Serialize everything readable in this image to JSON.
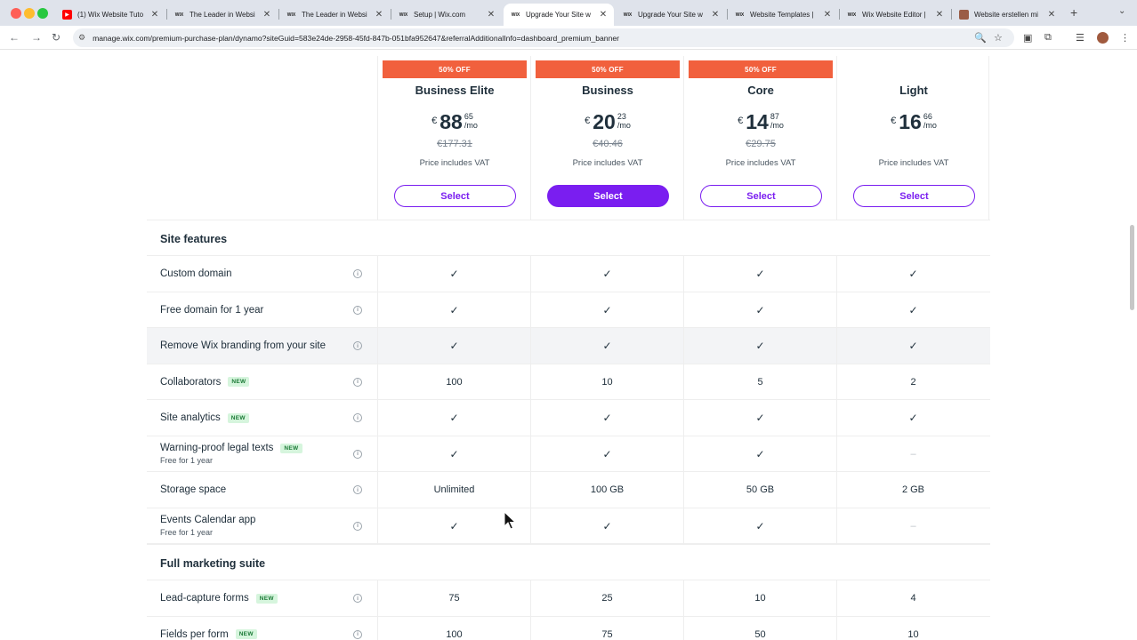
{
  "browser": {
    "tabs": [
      {
        "title": "(1) Wix Website Tuto",
        "icon": "youtube-icon",
        "active": false
      },
      {
        "title": "The Leader in Websi",
        "icon": "wix-icon",
        "active": false
      },
      {
        "title": "The Leader in Websi",
        "icon": "wix-icon",
        "active": false
      },
      {
        "title": "Setup | Wix.com",
        "icon": "wix-icon",
        "active": false
      },
      {
        "title": "Upgrade Your Site w",
        "icon": "wix-icon",
        "active": true
      },
      {
        "title": "Upgrade Your Site w",
        "icon": "wix-icon",
        "active": false
      },
      {
        "title": "Website Templates |",
        "icon": "wix-icon",
        "active": false
      },
      {
        "title": "Wix Website Editor |",
        "icon": "wix-icon",
        "active": false
      },
      {
        "title": "Website erstellen mi",
        "icon": "profile-photo-icon",
        "active": false
      }
    ],
    "new_tab": "+",
    "url": "manage.wix.com/premium-purchase-plan/dynamo?siteGuid=583e24de-2958-45fd-847b-051bfa952647&referralAdditionalInfo=dashboard_premium_banner"
  },
  "plans": [
    {
      "badge": "50% OFF",
      "name": "Business Elite",
      "currency": "€",
      "price_int": "88",
      "price_cents": "65",
      "period": "/mo",
      "old_price": "€177.31",
      "vat": "Price includes VAT",
      "cta": "Select",
      "primary": false
    },
    {
      "badge": "50% OFF",
      "name": "Business",
      "currency": "€",
      "price_int": "20",
      "price_cents": "23",
      "period": "/mo",
      "old_price": "€40.46",
      "vat": "Price includes VAT",
      "cta": "Select",
      "primary": true
    },
    {
      "badge": "50% OFF",
      "name": "Core",
      "currency": "€",
      "price_int": "14",
      "price_cents": "87",
      "period": "/mo",
      "old_price": "€29.75",
      "vat": "Price includes VAT",
      "cta": "Select",
      "primary": false
    },
    {
      "badge": "",
      "name": "Light",
      "currency": "€",
      "price_int": "16",
      "price_cents": "66",
      "period": "/mo",
      "old_price": "",
      "vat": "Price includes VAT",
      "cta": "Select",
      "primary": false
    }
  ],
  "sections": [
    {
      "title": "Site features",
      "rows": [
        {
          "name": "Custom domain",
          "new": false,
          "sub": "",
          "values": [
            "✓",
            "✓",
            "✓",
            "✓"
          ],
          "highlight": false
        },
        {
          "name": "Free domain for 1 year",
          "new": false,
          "sub": "",
          "values": [
            "✓",
            "✓",
            "✓",
            "✓"
          ],
          "highlight": false
        },
        {
          "name": "Remove Wix branding from your site",
          "new": false,
          "sub": "",
          "values": [
            "✓",
            "✓",
            "✓",
            "✓"
          ],
          "highlight": true
        },
        {
          "name": "Collaborators",
          "new": true,
          "sub": "",
          "values": [
            "100",
            "10",
            "5",
            "2"
          ],
          "highlight": false
        },
        {
          "name": "Site analytics",
          "new": true,
          "sub": "",
          "values": [
            "✓",
            "✓",
            "✓",
            "✓"
          ],
          "highlight": false
        },
        {
          "name": "Warning-proof legal texts",
          "new": true,
          "sub": "Free for 1 year",
          "values": [
            "✓",
            "✓",
            "✓",
            "–"
          ],
          "highlight": false
        },
        {
          "name": "Storage space",
          "new": false,
          "sub": "",
          "values": [
            "Unlimited",
            "100 GB",
            "50 GB",
            "2 GB"
          ],
          "highlight": false
        },
        {
          "name": "Events Calendar app",
          "new": false,
          "sub": "Free for 1 year",
          "values": [
            "✓",
            "✓",
            "✓",
            "–"
          ],
          "highlight": false
        }
      ]
    },
    {
      "title": "Full marketing suite",
      "rows": [
        {
          "name": "Lead-capture forms",
          "new": true,
          "sub": "",
          "values": [
            "75",
            "25",
            "10",
            "4"
          ],
          "highlight": false
        },
        {
          "name": "Fields per form",
          "new": true,
          "sub": "",
          "values": [
            "100",
            "75",
            "50",
            "10"
          ],
          "highlight": false
        }
      ]
    }
  ],
  "new_badge_label": "NEW",
  "info_glyph": "i",
  "colors": {
    "accent": "#7a1ef0",
    "badge": "#f1603d",
    "new_badge_bg": "#d6f5dd"
  }
}
